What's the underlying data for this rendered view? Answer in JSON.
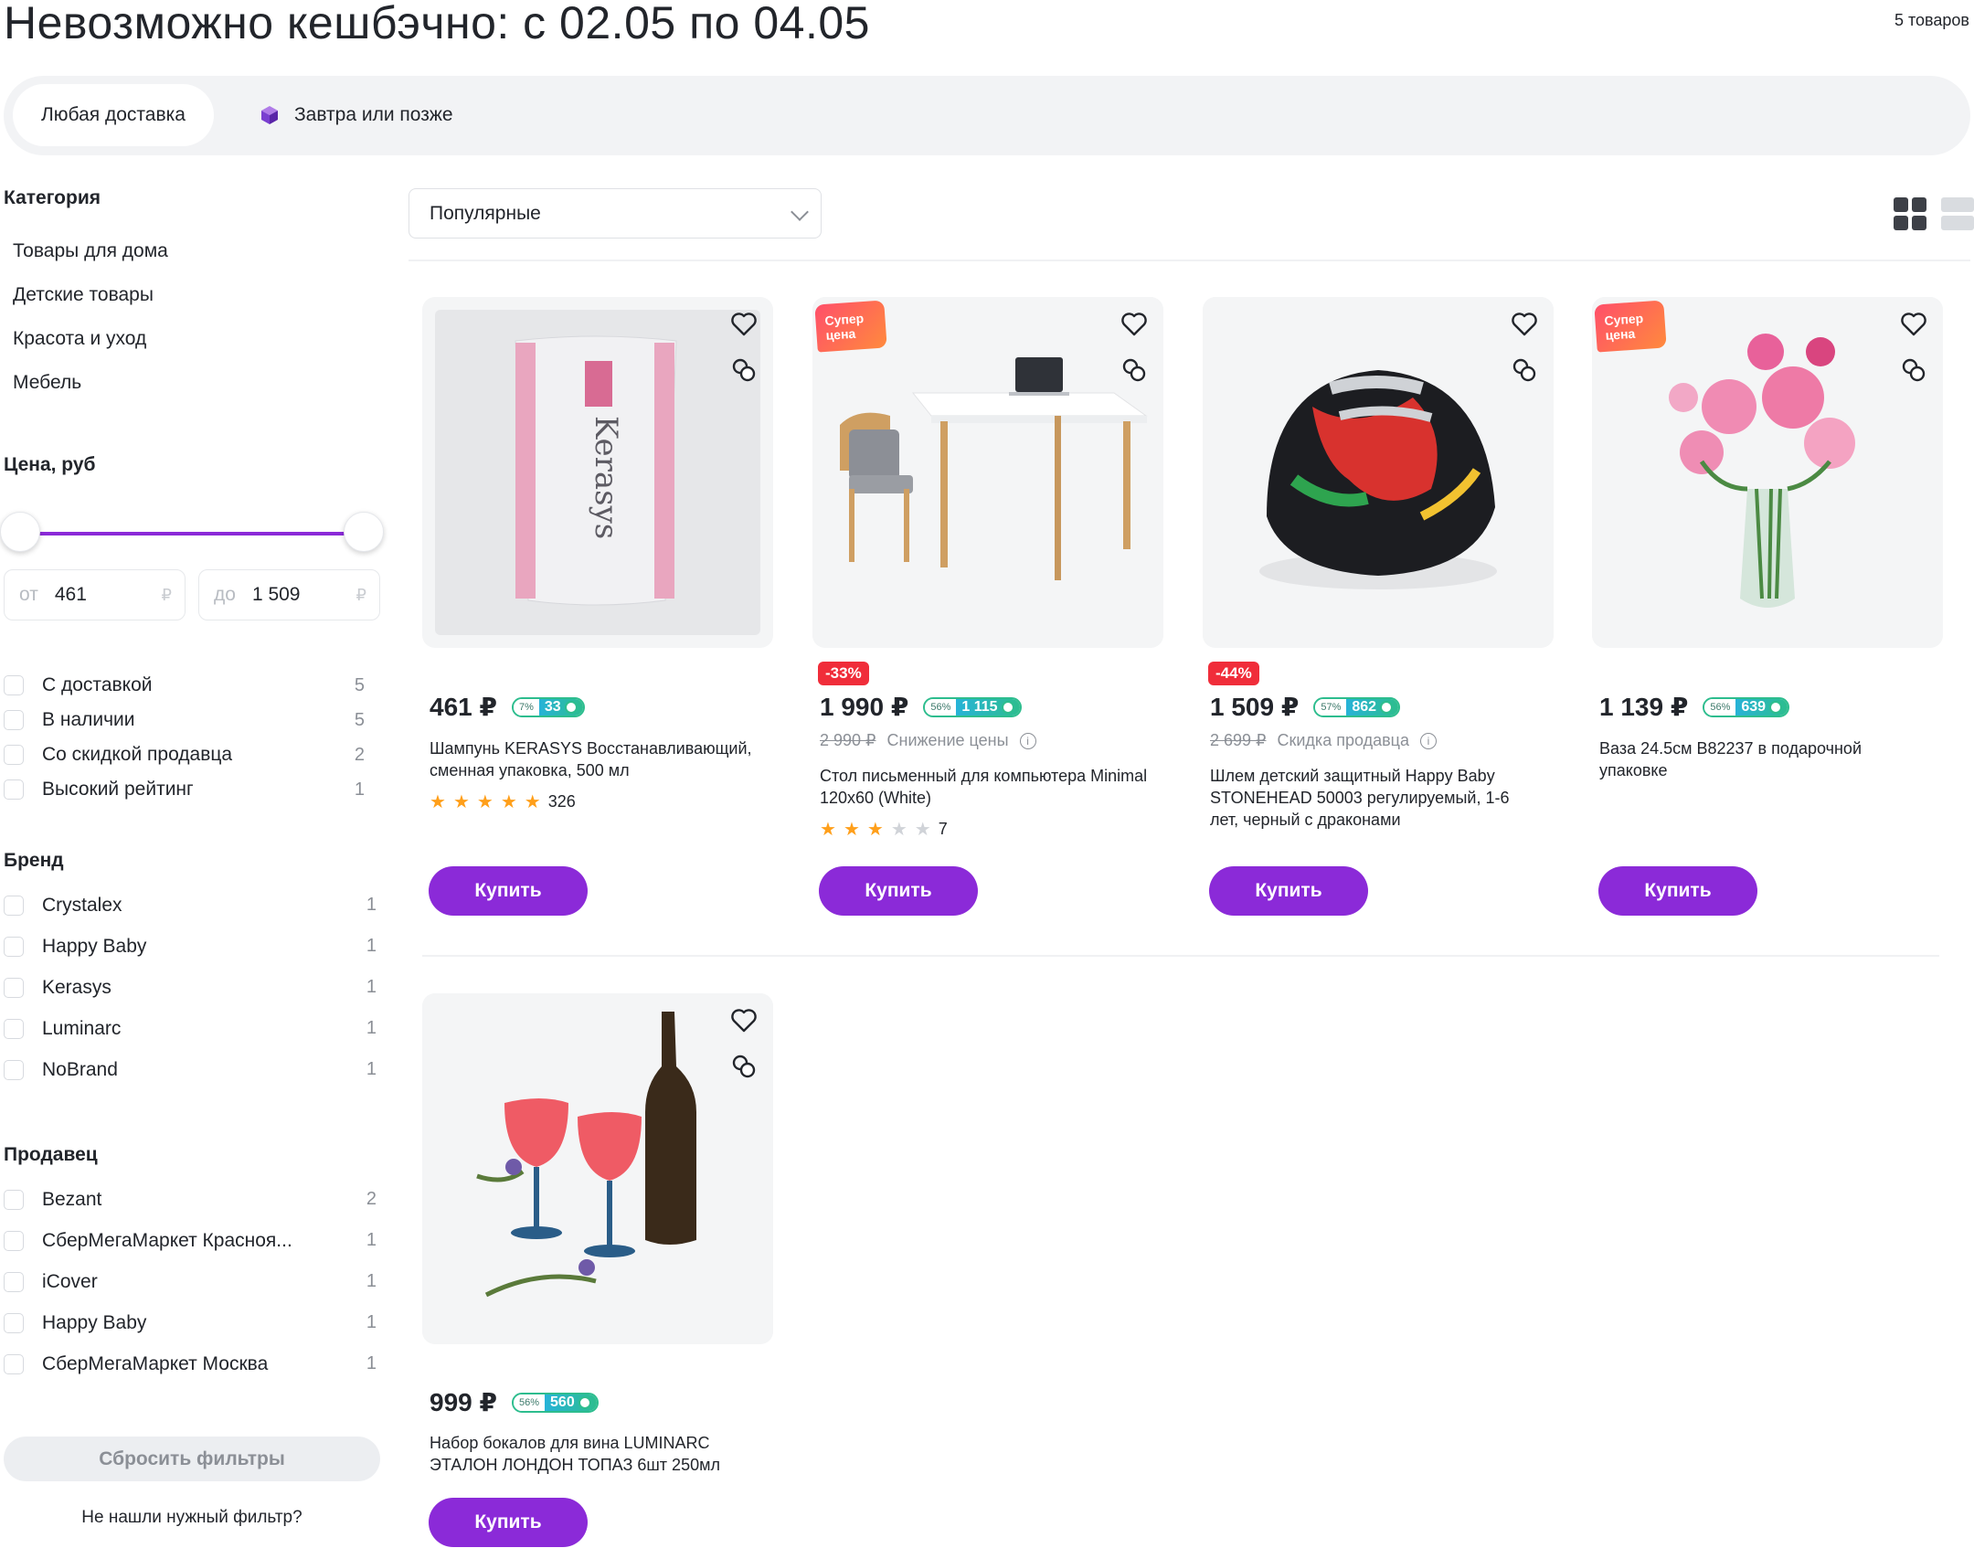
{
  "header": {
    "title": "Невозможно кешбэчно: с 02.05 по 04.05",
    "count": "5 товаров"
  },
  "delivery": {
    "any": "Любая доставка",
    "tomorrow": "Завтра или позже"
  },
  "category": {
    "heading": "Категория",
    "items": [
      "Товары для дома",
      "Детские товары",
      "Красота и уход",
      "Мебель"
    ]
  },
  "price": {
    "heading": "Цена, руб",
    "from_prefix": "от",
    "from_value": "461",
    "to_prefix": "до",
    "to_value": "1 509",
    "currency": "₽"
  },
  "flags": [
    {
      "label": "С доставкой",
      "count": "5"
    },
    {
      "label": "В наличии",
      "count": "5"
    },
    {
      "label": "Со скидкой продавца",
      "count": "2"
    },
    {
      "label": "Высокий рейтинг",
      "count": "1"
    }
  ],
  "brand": {
    "heading": "Бренд",
    "items": [
      {
        "label": "Crystalex",
        "count": "1"
      },
      {
        "label": "Happy Baby",
        "count": "1"
      },
      {
        "label": "Kerasys",
        "count": "1"
      },
      {
        "label": "Luminarc",
        "count": "1"
      },
      {
        "label": "NoBrand",
        "count": "1"
      }
    ]
  },
  "seller": {
    "heading": "Продавец",
    "items": [
      {
        "label": "Bezant",
        "count": "2"
      },
      {
        "label": "СберМегаМаркет Красноя...",
        "count": "1"
      },
      {
        "label": "iCover",
        "count": "1"
      },
      {
        "label": "Happy Baby",
        "count": "1"
      },
      {
        "label": "СберМегаМаркет Москва",
        "count": "1"
      }
    ]
  },
  "reset": "Сбросить фильтры",
  "not_found": "Не нашли нужный фильтр?",
  "sort": {
    "value": "Популярные"
  },
  "super_label": "Супер цена",
  "buy_label": "Купить",
  "products": [
    {
      "price": "461 ₽",
      "bonus_pct": "7%",
      "bonus": "33",
      "name": "Шампунь KERASYS Восстанавливающий, сменная упаковка, 500 мл",
      "rating": 5,
      "reviews": "326"
    },
    {
      "price": "1 990 ₽",
      "bonus_pct": "56%",
      "bonus": "1 115",
      "discount": "-33%",
      "old_price": "2 990 ₽",
      "old_note": "Снижение цены",
      "name": "Стол письменный для компьютера Minimal 120x60 (White)",
      "rating": 3,
      "reviews": "7"
    },
    {
      "price": "1 509 ₽",
      "bonus_pct": "57%",
      "bonus": "862",
      "discount": "-44%",
      "old_price": "2 699 ₽",
      "old_note": "Скидка продавца",
      "name": "Шлем детский защитный Happy Baby STONEHEAD 50003 регулируемый, 1-6 лет, черный с драконами"
    },
    {
      "price": "1 139 ₽",
      "bonus_pct": "56%",
      "bonus": "639",
      "name": "Ваза 24.5см B82237 в подарочной упаковке"
    },
    {
      "price": "999 ₽",
      "bonus_pct": "56%",
      "bonus": "560",
      "name": "Набор бокалов для вина LUMINARC ЭТАЛОН ЛОНДОН ТОПАЗ 6шт 250мл"
    }
  ],
  "colors": {
    "accent": "#8b2ad8",
    "discount": "#f02d3a",
    "bonus": "#2dbd8e",
    "star": "#ff9f1a"
  }
}
